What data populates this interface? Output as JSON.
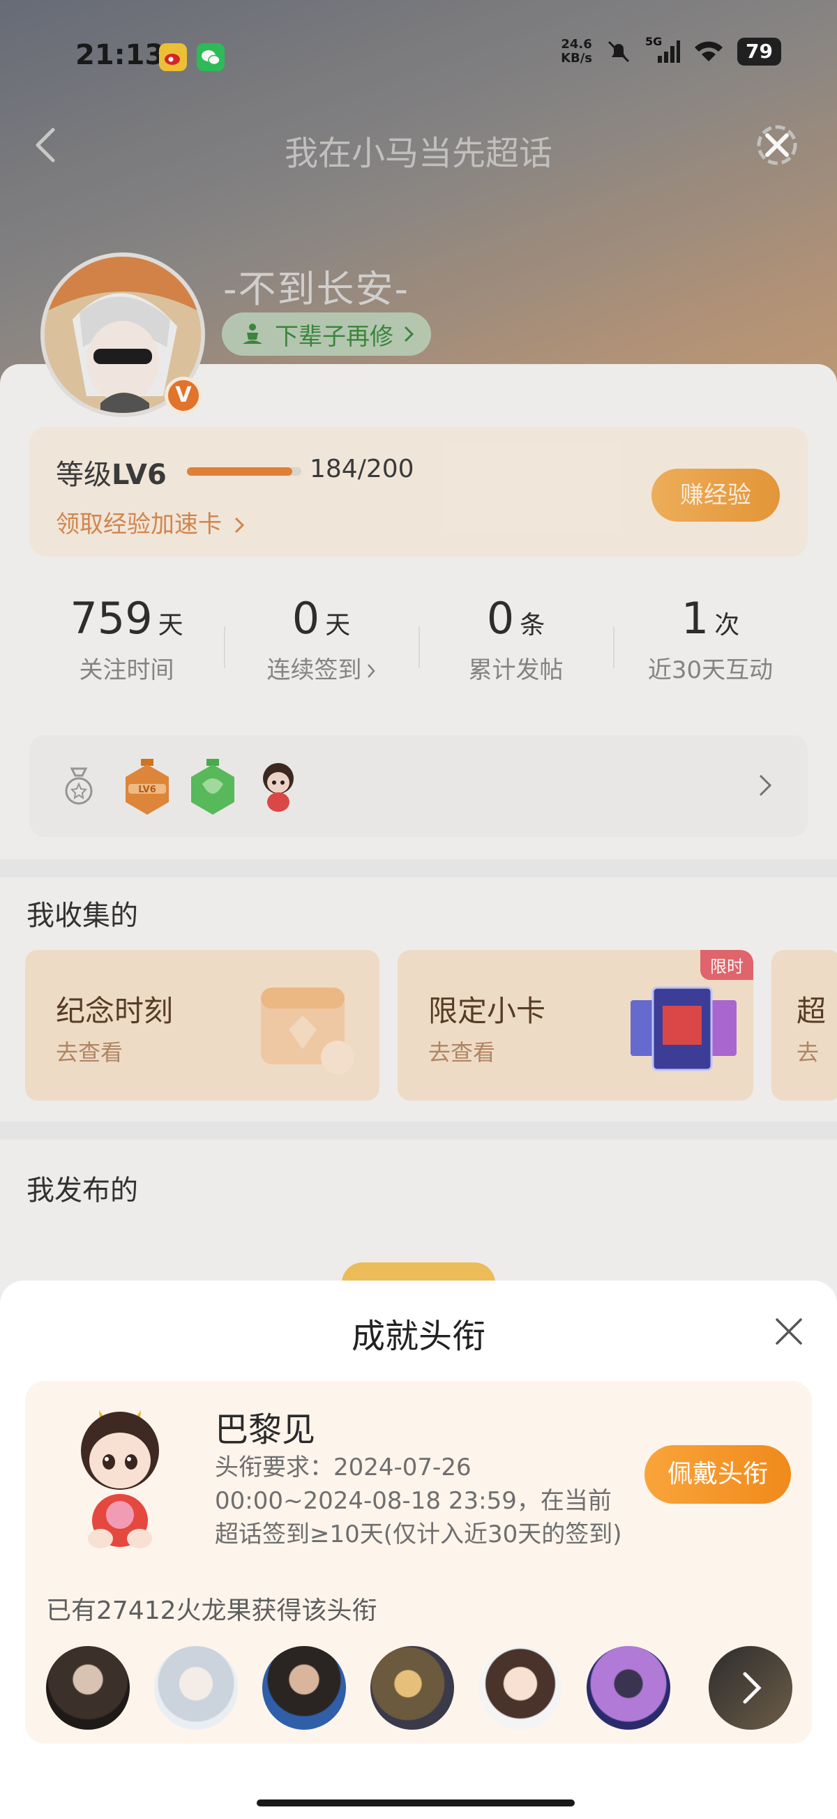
{
  "status_bar": {
    "time": "21:13",
    "net_speed_value": "24.6",
    "net_speed_unit": "KB/s",
    "network": "5G",
    "battery": "79",
    "apps": [
      "weibo-icon",
      "wechat-icon"
    ]
  },
  "header": {
    "title": "我在小马当先超话"
  },
  "profile": {
    "nickname": "-不到长安-",
    "rank_label": "下辈子再修",
    "verified_badge": "V"
  },
  "level": {
    "label_prefix": "等级",
    "level": "LV6",
    "progress_text": "184/200",
    "progress_fraction": 0.92,
    "accel_card_link": "领取经验加速卡",
    "earn_button": "赚经验"
  },
  "stats": [
    {
      "value": "759",
      "unit": "天",
      "label": "关注时间"
    },
    {
      "value": "0",
      "unit": "天",
      "label": "连续签到"
    },
    {
      "value": "0",
      "unit": "条",
      "label": "累计发帖"
    },
    {
      "value": "1",
      "unit": "次",
      "label": "近30天互动"
    }
  ],
  "collections": {
    "title": "我收集的",
    "items": [
      {
        "name": "纪念时刻",
        "sub": "去查看"
      },
      {
        "name": "限定小卡",
        "sub": "去查看",
        "tag": "限时"
      },
      {
        "name": "超",
        "sub": "去"
      }
    ]
  },
  "published": {
    "title": "我发布的"
  },
  "sheet": {
    "title": "成就头衔",
    "badge_name": "巴黎见",
    "requirement": "头衔要求：2024-07-26 00:00~2024-08-18 23:59，在当前超话签到≥10天(仅计入近30天的签到)",
    "wear_button": "佩戴头衔",
    "owners_text": "已有27412火龙果获得该头衔"
  },
  "colors": {
    "accent": "#f08a1c",
    "level_progress": "#e78536",
    "rank_green": "#3d8a3e",
    "limited_red": "#e7686f"
  }
}
